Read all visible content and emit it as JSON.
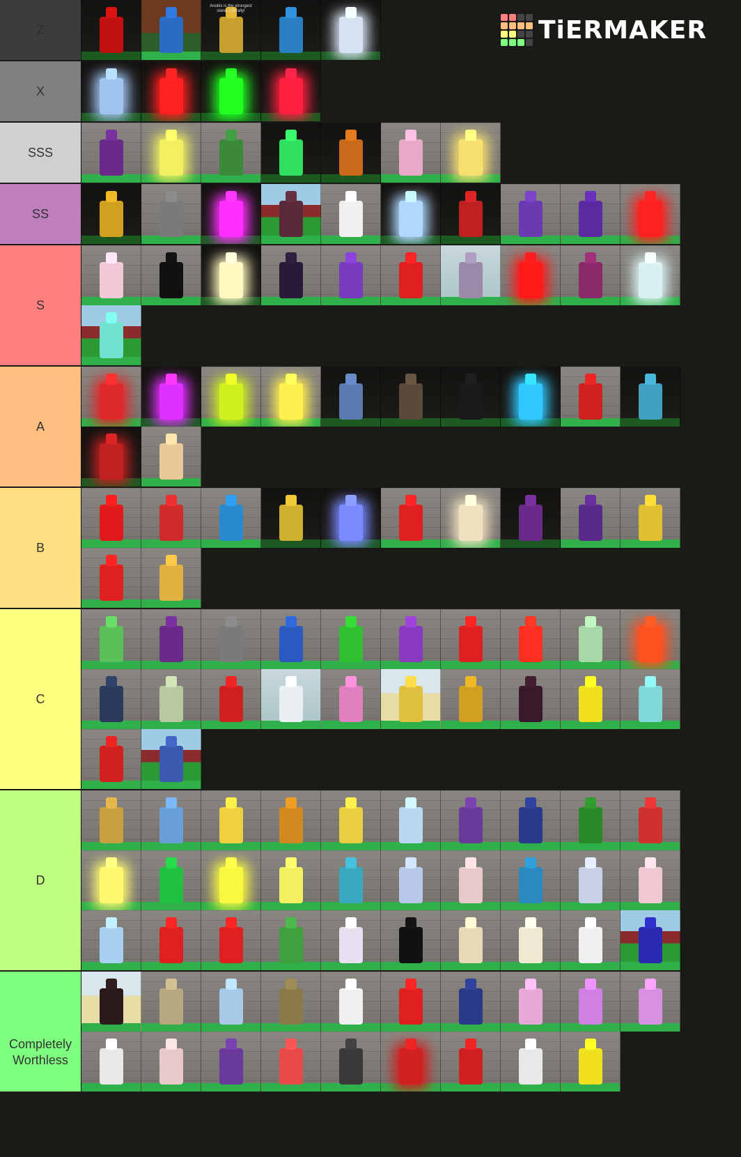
{
  "title": "TierMaker",
  "logo": {
    "text": "TiERMAKER",
    "grid_colors": [
      "#ff7f7f",
      "#ff7f7f",
      "#444444",
      "#444444",
      "#ffbf7f",
      "#ffbf7f",
      "#ffbf7f",
      "#ffbf7f",
      "#ffff7f",
      "#ffff7f",
      "#444444",
      "#444444",
      "#7fff7f",
      "#7fff7f",
      "#7fff7f",
      "#444444"
    ]
  },
  "tiers": [
    {
      "label": "Z",
      "color": "#3c3c3c",
      "label_color": "#2c2c2c",
      "items": [
        {
          "bg": "dark",
          "fig": "#c01010",
          "glow": false
        },
        {
          "bg": "brown",
          "fig": "#2a6bc4",
          "glow": false
        },
        {
          "bg": "dark",
          "fig": "#c8a030",
          "glow": false,
          "caption": "Anubis is the strongest stand. Literally!"
        },
        {
          "bg": "dark",
          "fig": "#2a7ec2",
          "glow": false
        },
        {
          "bg": "dark",
          "fig": "#d6e2f2",
          "glow": true
        }
      ]
    },
    {
      "label": "X",
      "color": "#808080",
      "items": [
        {
          "bg": "dark",
          "fig": "#9fc4f0",
          "glow": true
        },
        {
          "bg": "dark",
          "fig": "#ff2020",
          "glow": true
        },
        {
          "bg": "dark",
          "fig": "#20ff20",
          "glow": true
        },
        {
          "bg": "dark",
          "fig": "#ff2040",
          "glow": true
        }
      ]
    },
    {
      "label": "SSS",
      "color": "#d0d0d0",
      "items": [
        {
          "bg": "wall",
          "fig": "#6a2a8a",
          "glow": false
        },
        {
          "bg": "wall",
          "fig": "#f0f060",
          "glow": true
        },
        {
          "bg": "wall",
          "fig": "#3a8a3a",
          "glow": false
        },
        {
          "bg": "dark",
          "fig": "#30e060",
          "glow": false
        },
        {
          "bg": "dark",
          "fig": "#c86a1a",
          "glow": false
        },
        {
          "bg": "wall",
          "fig": "#e8a8c8",
          "glow": false
        },
        {
          "bg": "wall",
          "fig": "#f8e070",
          "glow": true
        }
      ]
    },
    {
      "label": "SS",
      "color": "#bf7fbf",
      "items": [
        {
          "bg": "dark",
          "fig": "#d0a020",
          "glow": false
        },
        {
          "bg": "wall",
          "fig": "#7a7a7a",
          "glow": false
        },
        {
          "bg": "dark",
          "fig": "#ff30ff",
          "glow": true
        },
        {
          "bg": "outdoor",
          "fig": "#5a2a3a",
          "glow": false
        },
        {
          "bg": "wall",
          "fig": "#f0f0f0",
          "glow": false
        },
        {
          "bg": "dark",
          "fig": "#b0d8ff",
          "glow": true
        },
        {
          "bg": "dark",
          "fig": "#c02020",
          "glow": false
        },
        {
          "bg": "wall",
          "fig": "#6a3ab0",
          "glow": false
        },
        {
          "bg": "wall",
          "fig": "#5a2aa0",
          "glow": false
        },
        {
          "bg": "wall",
          "fig": "#ff2020",
          "glow": true
        }
      ]
    },
    {
      "label": "S",
      "color": "#ff7f7f",
      "items": [
        {
          "bg": "wall",
          "fig": "#f2c8d8",
          "glow": false
        },
        {
          "bg": "wall",
          "fig": "#111111",
          "glow": false
        },
        {
          "bg": "dark",
          "fig": "#fff8c0",
          "glow": true
        },
        {
          "bg": "wall",
          "fig": "#2a1a3a",
          "glow": false
        },
        {
          "bg": "wall",
          "fig": "#7a3ac0",
          "glow": false
        },
        {
          "bg": "wall",
          "fig": "#e02020",
          "glow": false
        },
        {
          "bg": "fog",
          "fig": "#9a8aa8",
          "glow": false
        },
        {
          "bg": "wall",
          "fig": "#ff1a1a",
          "glow": true
        },
        {
          "bg": "wall",
          "fig": "#8a2a6a",
          "glow": false
        },
        {
          "bg": "wall",
          "fig": "#d8f0f0",
          "glow": true
        },
        {
          "bg": "outdoor",
          "fig": "#70e0d0",
          "glow": false
        }
      ]
    },
    {
      "label": "A",
      "color": "#ffbf7f",
      "items": [
        {
          "bg": "wall",
          "fig": "#e02a2a",
          "glow": true
        },
        {
          "bg": "dark",
          "fig": "#e030ff",
          "glow": true
        },
        {
          "bg": "wall",
          "fig": "#d0f020",
          "glow": true
        },
        {
          "bg": "wall",
          "fig": "#fff050",
          "glow": true
        },
        {
          "bg": "dark",
          "fig": "#5a7ab0",
          "glow": false
        },
        {
          "bg": "dark",
          "fig": "#5a4a3a",
          "glow": false
        },
        {
          "bg": "dark",
          "fig": "#1a1a1a",
          "glow": false
        },
        {
          "bg": "dark",
          "fig": "#30c8ff",
          "glow": true
        },
        {
          "bg": "wall",
          "fig": "#d02020",
          "glow": false
        },
        {
          "bg": "dark",
          "fig": "#40a0c0",
          "glow": false
        },
        {
          "bg": "dark",
          "fig": "#c02020",
          "glow": true
        },
        {
          "bg": "wall",
          "fig": "#e8c898",
          "glow": false
        }
      ]
    },
    {
      "label": "B",
      "color": "#ffdf7f",
      "items": [
        {
          "bg": "wall",
          "fig": "#e01a1a",
          "glow": false
        },
        {
          "bg": "wall",
          "fig": "#d02a2a",
          "glow": false
        },
        {
          "bg": "wall",
          "fig": "#2a8ad0",
          "glow": false
        },
        {
          "bg": "dark",
          "fig": "#d0b030",
          "glow": false
        },
        {
          "bg": "dark",
          "fig": "#7a8aff",
          "glow": true
        },
        {
          "bg": "wall",
          "fig": "#e02020",
          "glow": false
        },
        {
          "bg": "wall",
          "fig": "#f0e0c0",
          "glow": true
        },
        {
          "bg": "dark",
          "fig": "#6a2a8a",
          "glow": false
        },
        {
          "bg": "wall",
          "fig": "#5a2a8a",
          "glow": false
        },
        {
          "bg": "wall",
          "fig": "#e0c030",
          "glow": false
        },
        {
          "bg": "wall",
          "fig": "#e02020",
          "glow": false
        },
        {
          "bg": "wall",
          "fig": "#e0b040",
          "glow": false
        }
      ]
    },
    {
      "label": "C",
      "color": "#ffff7f",
      "items": [
        {
          "bg": "wall",
          "fig": "#5ac05a",
          "glow": false
        },
        {
          "bg": "wall",
          "fig": "#6a2a8a",
          "glow": false
        },
        {
          "bg": "wall",
          "fig": "#7a7a7a",
          "glow": false
        },
        {
          "bg": "wall",
          "fig": "#2a5ac0",
          "glow": false
        },
        {
          "bg": "wall",
          "fig": "#30c030",
          "glow": false
        },
        {
          "bg": "wall",
          "fig": "#8a3ac0",
          "glow": false
        },
        {
          "bg": "wall",
          "fig": "#e02020",
          "glow": false
        },
        {
          "bg": "wall",
          "fig": "#ff3020",
          "glow": false
        },
        {
          "bg": "wall",
          "fig": "#a8d8a8",
          "glow": false
        },
        {
          "bg": "wall",
          "fig": "#ff5020",
          "glow": true
        },
        {
          "bg": "wall",
          "fig": "#2a3a5a",
          "glow": false
        },
        {
          "bg": "wall",
          "fig": "#b8c8a0",
          "glow": false
        },
        {
          "bg": "wall",
          "fig": "#d02020",
          "glow": false
        },
        {
          "bg": "fog",
          "fig": "#e8eef2",
          "glow": false
        },
        {
          "bg": "wall",
          "fig": "#e080c0",
          "glow": false
        },
        {
          "bg": "sand",
          "fig": "#e0c040",
          "glow": false
        },
        {
          "bg": "wall",
          "fig": "#d0a020",
          "glow": false
        },
        {
          "bg": "wall",
          "fig": "#3a1a2a",
          "glow": false
        },
        {
          "bg": "wall",
          "fig": "#f0e020",
          "glow": false
        },
        {
          "bg": "wall",
          "fig": "#80d8d8",
          "glow": false
        },
        {
          "bg": "wall",
          "fig": "#d02020",
          "glow": false
        },
        {
          "bg": "outdoor",
          "fig": "#3a5ab0",
          "glow": false
        }
      ]
    },
    {
      "label": "D",
      "color": "#bfff7f",
      "items": [
        {
          "bg": "wall",
          "fig": "#c8a040",
          "glow": false
        },
        {
          "bg": "wall",
          "fig": "#6aa0d8",
          "glow": false
        },
        {
          "bg": "wall",
          "fig": "#f0d040",
          "glow": false
        },
        {
          "bg": "wall",
          "fig": "#d08a20",
          "glow": false
        },
        {
          "bg": "wall",
          "fig": "#e8d040",
          "glow": false
        },
        {
          "bg": "wall",
          "fig": "#b8d8f0",
          "glow": false
        },
        {
          "bg": "wall",
          "fig": "#6a3a9a",
          "glow": false
        },
        {
          "bg": "wall",
          "fig": "#2a3a8a",
          "glow": false
        },
        {
          "bg": "wall",
          "fig": "#2a8a2a",
          "glow": false
        },
        {
          "bg": "wall",
          "fig": "#d03030",
          "glow": false
        },
        {
          "bg": "wall",
          "fig": "#fff870",
          "glow": true
        },
        {
          "bg": "wall",
          "fig": "#20c040",
          "glow": false
        },
        {
          "bg": "wall",
          "fig": "#f8f840",
          "glow": true
        },
        {
          "bg": "wall",
          "fig": "#f0f060",
          "glow": false
        },
        {
          "bg": "wall",
          "fig": "#3aa8c0",
          "glow": false
        },
        {
          "bg": "wall",
          "fig": "#b8c8e8",
          "glow": false
        },
        {
          "bg": "wall",
          "fig": "#e8c8c8",
          "glow": false
        },
        {
          "bg": "wall",
          "fig": "#2a8ac0",
          "glow": false
        },
        {
          "bg": "wall",
          "fig": "#c8d0e8",
          "glow": false
        },
        {
          "bg": "wall",
          "fig": "#f0c8d0",
          "glow": false
        },
        {
          "bg": "wall",
          "fig": "#a8d0f0",
          "glow": false
        },
        {
          "bg": "wall",
          "fig": "#e02020",
          "glow": false
        },
        {
          "bg": "wall",
          "fig": "#e02020",
          "glow": false
        },
        {
          "bg": "wall",
          "fig": "#40a040",
          "glow": false
        },
        {
          "bg": "wall",
          "fig": "#e8e0f0",
          "glow": false
        },
        {
          "bg": "wall",
          "fig": "#111111",
          "glow": false
        },
        {
          "bg": "wall",
          "fig": "#e8d8b8",
          "glow": false
        },
        {
          "bg": "wall",
          "fig": "#f0e8d0",
          "glow": false
        },
        {
          "bg": "wall",
          "fig": "#f0f0f0",
          "glow": false
        },
        {
          "bg": "outdoor",
          "fig": "#2a2ab0",
          "glow": false
        }
      ]
    },
    {
      "label": "Completely Worthless",
      "color": "#7fff7f",
      "items": [
        {
          "bg": "sand",
          "fig": "#2a1a1a",
          "glow": false
        },
        {
          "bg": "wall",
          "fig": "#b8a880",
          "glow": false
        },
        {
          "bg": "wall",
          "fig": "#a8c8e8",
          "glow": false
        },
        {
          "bg": "wall",
          "fig": "#8a7a4a",
          "glow": false
        },
        {
          "bg": "wall",
          "fig": "#f0f0f0",
          "glow": false
        },
        {
          "bg": "wall",
          "fig": "#e02020",
          "glow": false
        },
        {
          "bg": "wall",
          "fig": "#2a3a8a",
          "glow": false
        },
        {
          "bg": "wall",
          "fig": "#e8a8d8",
          "glow": false
        },
        {
          "bg": "wall",
          "fig": "#d080e0",
          "glow": false
        },
        {
          "bg": "wall",
          "fig": "#d890e0",
          "glow": false
        },
        {
          "bg": "wall",
          "fig": "#e8e8e8",
          "glow": false
        },
        {
          "bg": "wall",
          "fig": "#e8c8c8",
          "glow": false
        },
        {
          "bg": "wall",
          "fig": "#6a3a9a",
          "glow": false
        },
        {
          "bg": "wall",
          "fig": "#e84a4a",
          "glow": false
        },
        {
          "bg": "wall",
          "fig": "#3a3a3a",
          "glow": false
        },
        {
          "bg": "wall",
          "fig": "#d02020",
          "glow": true
        },
        {
          "bg": "wall",
          "fig": "#d02020",
          "glow": false
        },
        {
          "bg": "wall",
          "fig": "#e8e8e8",
          "glow": false
        },
        {
          "bg": "wall",
          "fig": "#f0e020",
          "glow": false
        }
      ]
    }
  ]
}
